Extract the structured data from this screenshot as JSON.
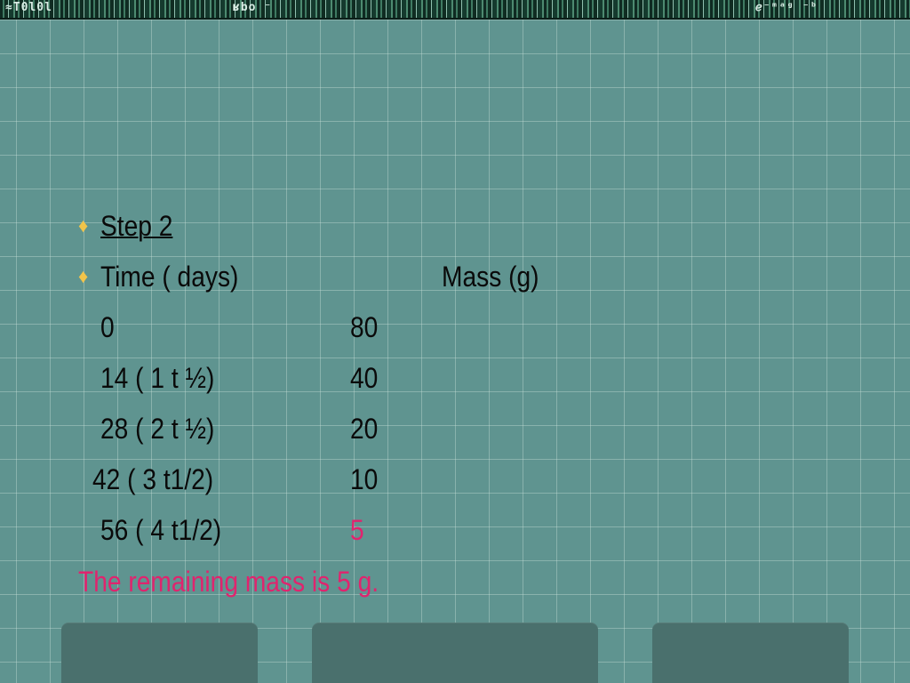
{
  "header": {
    "left_glyphs": "≈T0l0l",
    "center_glyphs": "ʁbo ⁻",
    "right_glyphs": "ℯ⁻ᵐᵃᵍ ⁻ᵇ"
  },
  "slide": {
    "step_title": "Step 2",
    "col_time_header": "Time ( days)",
    "col_mass_header": "Mass (g)",
    "rows": [
      {
        "time": "0",
        "mass": "80"
      },
      {
        "time": "14 ( 1 t ½)",
        "mass": "40"
      },
      {
        "time": "28 ( 2 t ½)",
        "mass": "20"
      },
      {
        "time": "42 ( 3 t1/2)",
        "mass": "10"
      },
      {
        "time": "56 ( 4 t1/2)",
        "mass": "5"
      }
    ],
    "conclusion": "The remaining mass is 5 g."
  },
  "colors": {
    "background": "#5f9490",
    "highlight": "#e0246e",
    "bullet": "#f2c44a",
    "tab": "#4a706d"
  },
  "icons": {
    "bullet": "diamond-bullet-icon"
  }
}
